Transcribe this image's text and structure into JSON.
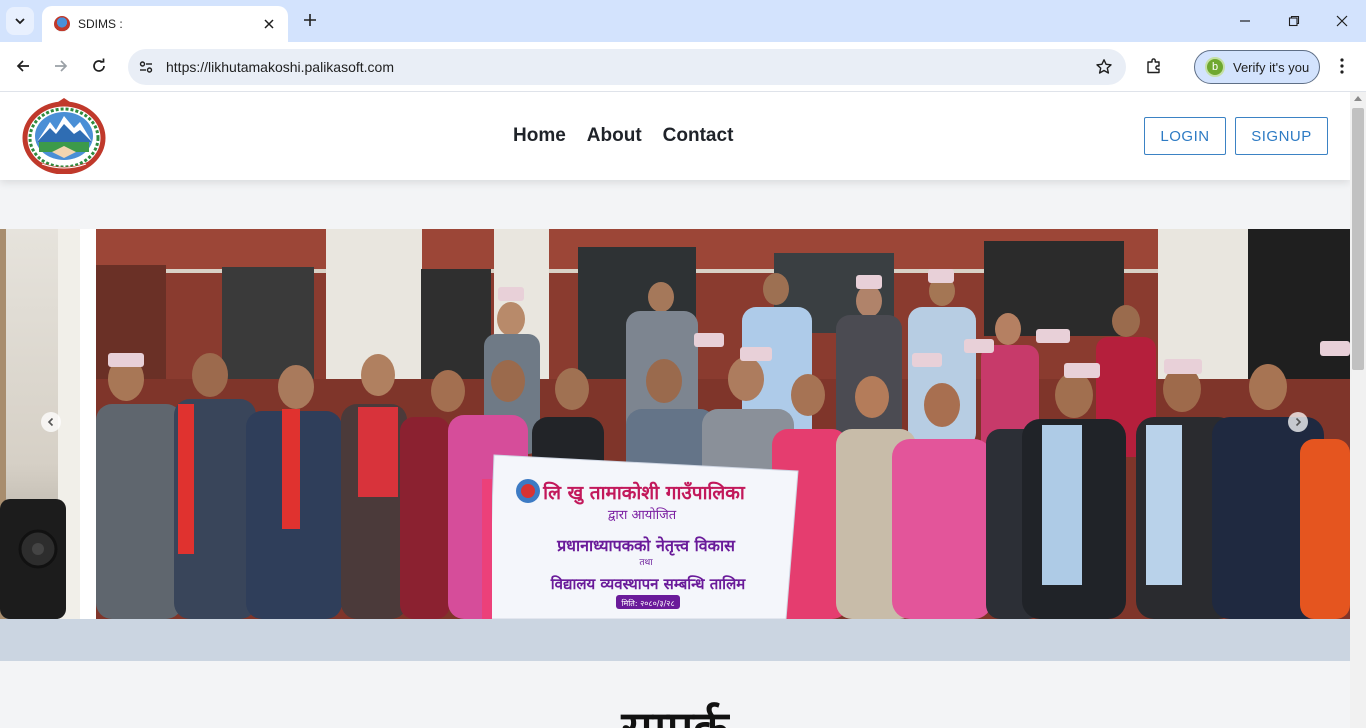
{
  "browser": {
    "tab": {
      "title": "SDIMS :",
      "favicon": "nepal-emblem-favicon"
    },
    "address_bar": {
      "url": "https://likhutamakoshi.palikasoft.com"
    },
    "profile": {
      "avatar_letter": "b",
      "label": "Verify it's you"
    },
    "icons": [
      "tab-search-icon",
      "close-icon",
      "plus-icon",
      "minimize-icon",
      "restore-icon",
      "back-icon",
      "forward-icon",
      "reload-icon",
      "site-info-icon",
      "star-icon",
      "extensions-icon",
      "kebab-menu-icon"
    ]
  },
  "site": {
    "logo": "nepal-government-emblem",
    "nav": [
      {
        "label": "Home"
      },
      {
        "label": "About"
      },
      {
        "label": "Contact"
      }
    ],
    "auth": {
      "login": "LOGIN",
      "signup": "SIGNUP"
    },
    "accent_color": "#2e7bc4",
    "carousel": {
      "banner_line1": "लि खु तामाकोशी गाउँपालिका",
      "banner_line2": "द्वारा आयोजित",
      "banner_line3": "प्रधानाध्यापकको नेतृत्त्व विकास",
      "banner_line4": "तथा",
      "banner_line5": "विद्यालय व्यवस्थापन सम्बन्धि तालिम",
      "banner_date": "मिति: २०८०/३/२८",
      "prev_arrow": "chevron-left-icon",
      "next_arrow": "chevron-right-icon"
    },
    "section_heading": "सम्पर्क"
  }
}
